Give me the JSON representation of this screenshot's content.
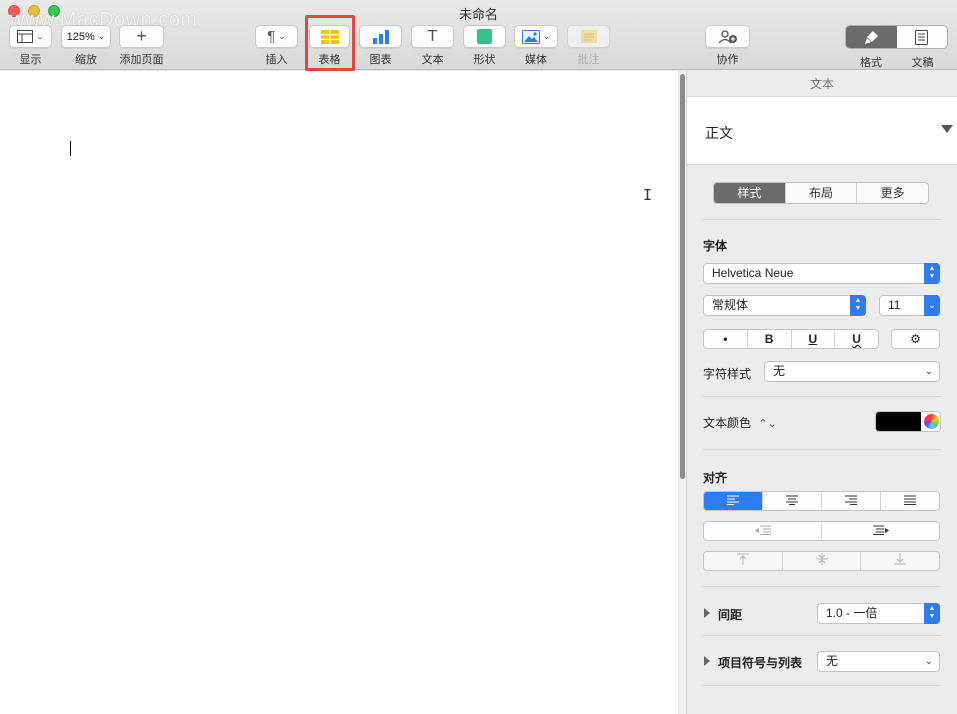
{
  "window": {
    "title": "未命名",
    "watermark": "www.MacDown.com"
  },
  "toolbar": {
    "view": {
      "label": "显示",
      "icon": "sidebar-icon"
    },
    "zoom": {
      "label": "缩放",
      "value": "125%"
    },
    "add_page": {
      "label": "添加页面",
      "symbol": "+"
    },
    "insert": {
      "label": "插入",
      "symbol": "¶"
    },
    "table": {
      "label": "表格",
      "icon": "table-icon",
      "highlighted": true
    },
    "chart": {
      "label": "图表",
      "icon": "chart-icon"
    },
    "text": {
      "label": "文本",
      "symbol": "T"
    },
    "shape": {
      "label": "形状",
      "icon": "shape-icon"
    },
    "media": {
      "label": "媒体",
      "icon": "media-icon"
    },
    "comment": {
      "label": "批注",
      "icon": "comment-icon",
      "disabled": true
    },
    "collaborate": {
      "label": "协作",
      "icon": "collaborate-icon"
    },
    "format": {
      "label": "格式",
      "icon": "paintbrush-icon",
      "selected": true
    },
    "document": {
      "label": "文稿",
      "icon": "document-icon"
    }
  },
  "inspector": {
    "header": "文本",
    "paragraph_style": "正文",
    "tabs": [
      "样式",
      "布局",
      "更多"
    ],
    "selected_tab": "样式",
    "font": {
      "section": "字体",
      "family": "Helvetica Neue",
      "typeface": "常规体",
      "size": "11",
      "style_buttons": [
        "•",
        "B",
        "U",
        "U"
      ],
      "gear": "⚙"
    },
    "char_style": {
      "label": "字符样式",
      "value": "无"
    },
    "text_color": {
      "label": "文本颜色",
      "color": "#000000"
    },
    "alignment": {
      "section": "对齐",
      "selected": "left"
    },
    "spacing": {
      "label": "间距",
      "value": "1.0 - 一倍"
    },
    "bullets": {
      "label": "项目符号与列表",
      "value": "无"
    }
  },
  "colors": {
    "accent": "#2f7bf5",
    "highlight_box": "#e8463a"
  }
}
